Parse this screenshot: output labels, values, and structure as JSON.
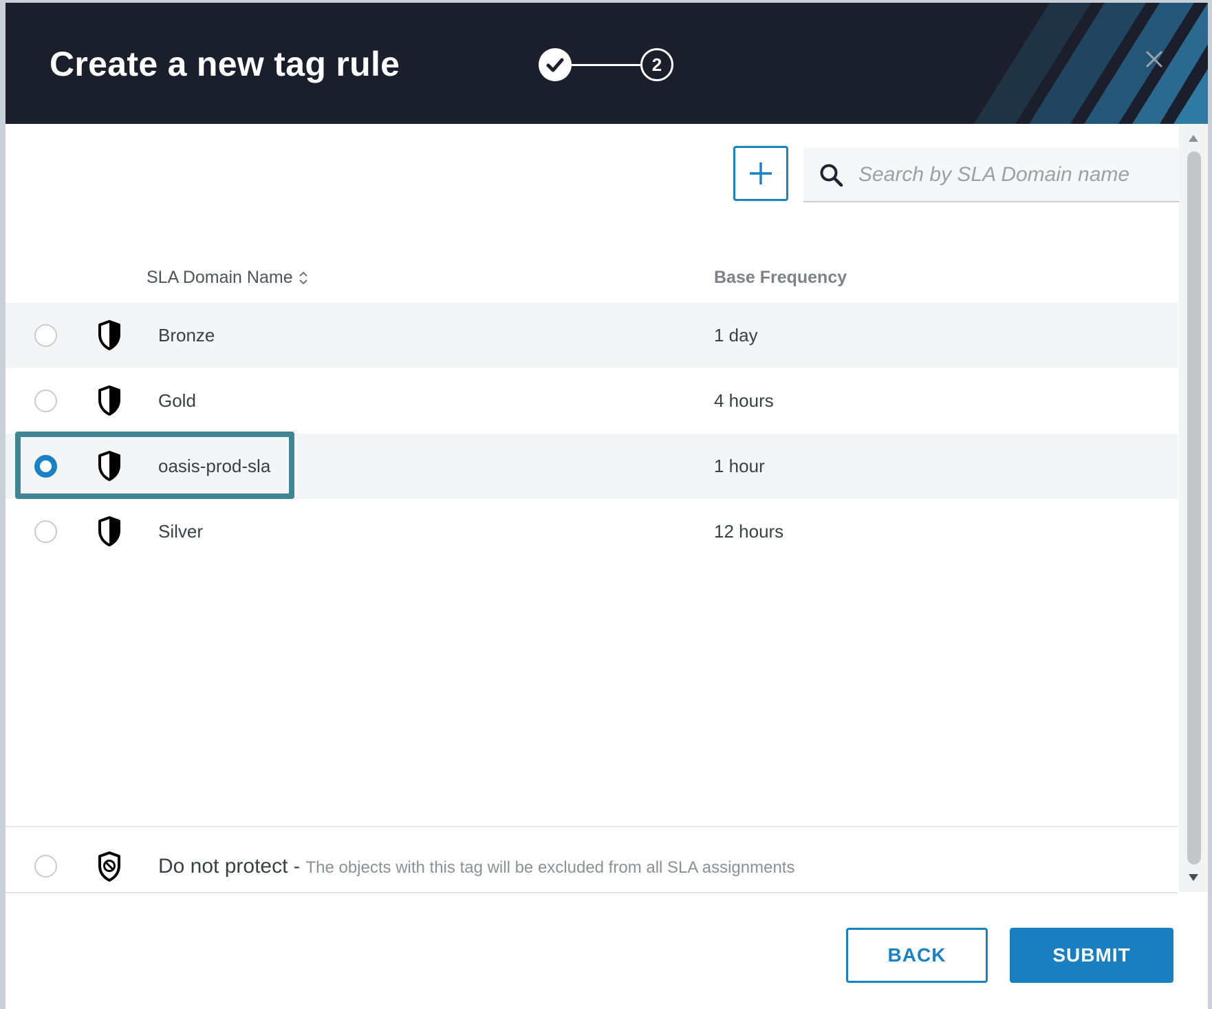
{
  "dialog": {
    "title": "Create a new tag rule",
    "step_two_label": "2"
  },
  "toolbar": {
    "search_placeholder": "Search by SLA Domain name"
  },
  "table": {
    "headers": {
      "name": "SLA Domain Name",
      "frequency": "Base Frequency"
    },
    "rows": [
      {
        "name": "Bronze",
        "frequency": "1 day",
        "selected": false
      },
      {
        "name": "Gold",
        "frequency": "4 hours",
        "selected": false
      },
      {
        "name": "oasis-prod-sla",
        "frequency": "1 hour",
        "selected": true
      },
      {
        "name": "Silver",
        "frequency": "12 hours",
        "selected": false
      }
    ]
  },
  "do_not_protect": {
    "title": "Do not protect",
    "separator": "-",
    "description": "The objects with this tag will be excluded from all SLA assignments"
  },
  "footer": {
    "back_label": "BACK",
    "submit_label": "SUBMIT"
  },
  "colors": {
    "accent": "#1a82c4",
    "header_bg": "#1b1f2c",
    "highlight": "#3f8594"
  },
  "icons": {
    "step_done": "check-icon",
    "close": "close-icon",
    "add": "plus-icon",
    "search": "search-icon",
    "sla": "shield-icon",
    "do_not_protect": "shield-ban-icon",
    "sort": "sort-icon"
  }
}
